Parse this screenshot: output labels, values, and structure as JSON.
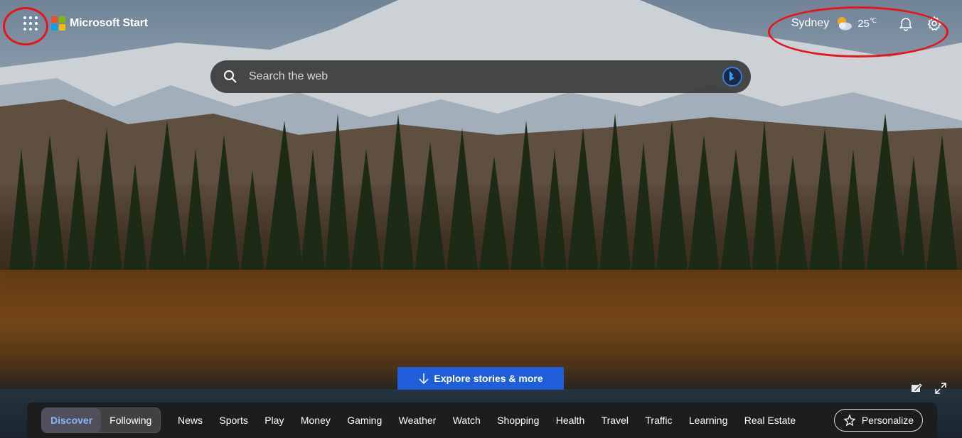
{
  "header": {
    "brand": "Microsoft Start",
    "location": {
      "city": "Sydney",
      "temperature": "25",
      "unit": "℃"
    }
  },
  "search": {
    "placeholder": "Search the web"
  },
  "explore_button": {
    "label": "Explore stories & more"
  },
  "nav": {
    "toggle": [
      "Discover",
      "Following"
    ],
    "items": [
      "News",
      "Sports",
      "Play",
      "Money",
      "Gaming",
      "Weather",
      "Watch",
      "Shopping",
      "Health",
      "Travel",
      "Traffic",
      "Learning",
      "Real Estate"
    ],
    "personalize_label": "Personalize"
  },
  "colors": {
    "logo": [
      "#f25022",
      "#7fba00",
      "#00a4ef",
      "#ffb900"
    ],
    "annotation": "#e8141c",
    "explore_button": "#1f5ed8",
    "active_tab": "#8ab4f8"
  },
  "icons": {
    "apps": "grid-icon",
    "weather": "partly-cloudy-icon",
    "notifications": "bell-icon",
    "settings": "gear-icon",
    "search": "search-icon",
    "bing": "bing-icon",
    "explore": "arrow-down-icon",
    "edit_background": "edit-background-icon",
    "expand": "expand-icon",
    "personalize": "sparkle-star-icon"
  }
}
